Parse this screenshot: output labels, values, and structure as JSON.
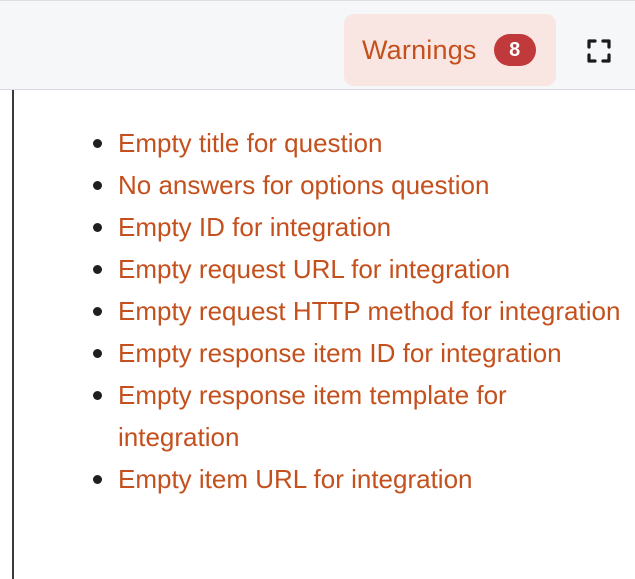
{
  "toolbar": {
    "warnings_label": "Warnings",
    "warnings_count": "8",
    "fullscreen_icon": "expand-corners-icon"
  },
  "warnings": [
    "Empty title for question",
    "No answers for options question",
    "Empty ID for integration",
    "Empty request URL for integration",
    "Empty request HTTP method for integration",
    "Empty response item ID for integration",
    "Empty response item template for integration",
    "Empty item URL for integration"
  ],
  "colors": {
    "accent": "#c4501e",
    "badge": "#c0393b",
    "button_bg": "#f9e6e2",
    "toolbar_bg": "#f6f7f9"
  }
}
